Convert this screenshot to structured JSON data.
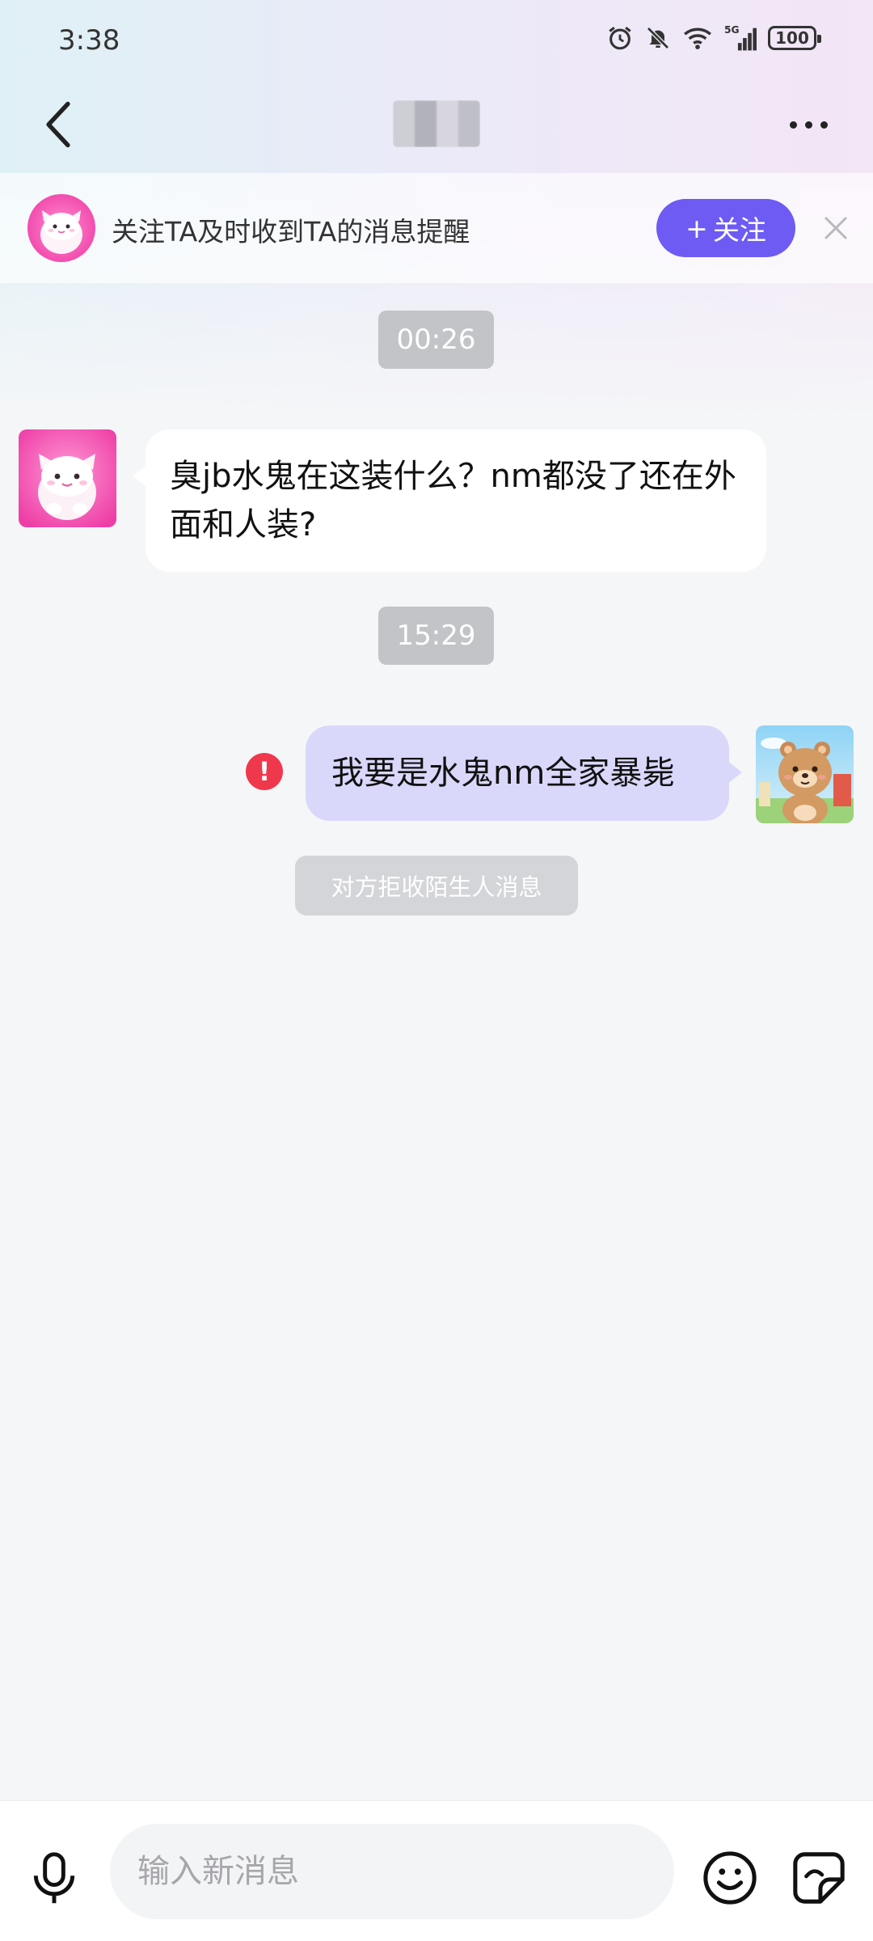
{
  "status_bar": {
    "time": "3:38",
    "battery": "100",
    "network": "5G",
    "icons": [
      "alarm-icon",
      "mute-bell-icon",
      "wifi-icon",
      "signal-icon",
      "battery-icon"
    ]
  },
  "header": {
    "title": "",
    "back_icon": "chevron-left-icon",
    "more_icon": "more-dots-icon"
  },
  "follow_banner": {
    "text": "关注TA及时收到TA的消息提醒",
    "button_label": "关注",
    "button_prefix": "+",
    "close_icon": "close-icon",
    "accent_color": "#6d5bf3"
  },
  "messages": [
    {
      "type": "timestamp",
      "text": "00:26"
    },
    {
      "type": "incoming",
      "text": "臭jb水鬼在这装什么？nm都没了还在外面和人装?"
    },
    {
      "type": "timestamp",
      "text": "15:29"
    },
    {
      "type": "outgoing",
      "text": "我要是水鬼nm全家暴毙",
      "status": "failed"
    },
    {
      "type": "system",
      "text": "对方拒收陌生人消息"
    }
  ],
  "input_bar": {
    "placeholder": "输入新消息",
    "mic_icon": "microphone-icon",
    "emoji_icon": "emoji-icon",
    "sticker_icon": "sticker-icon"
  },
  "colors": {
    "outgoing_bubble": "#d9d8fb",
    "incoming_bubble": "#ffffff",
    "error": "#f0384c",
    "timestamp_bg": "#c3c4c8"
  }
}
